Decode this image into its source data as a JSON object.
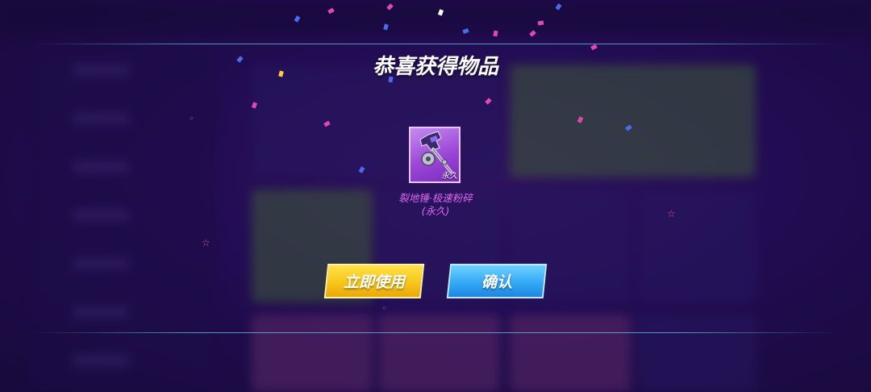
{
  "dialog": {
    "title": "恭喜获得物品",
    "item": {
      "icon": "hammer-icon",
      "tag": "永久",
      "name": "裂地锤·极速粉碎",
      "duration": "(永久)"
    },
    "buttons": {
      "use_label": "立即使用",
      "confirm_label": "确认"
    }
  },
  "colors": {
    "item_name": "#e067f0",
    "use_button": "#f8c61a",
    "confirm_button": "#34a9f4",
    "item_frame": "#9b46d6"
  }
}
